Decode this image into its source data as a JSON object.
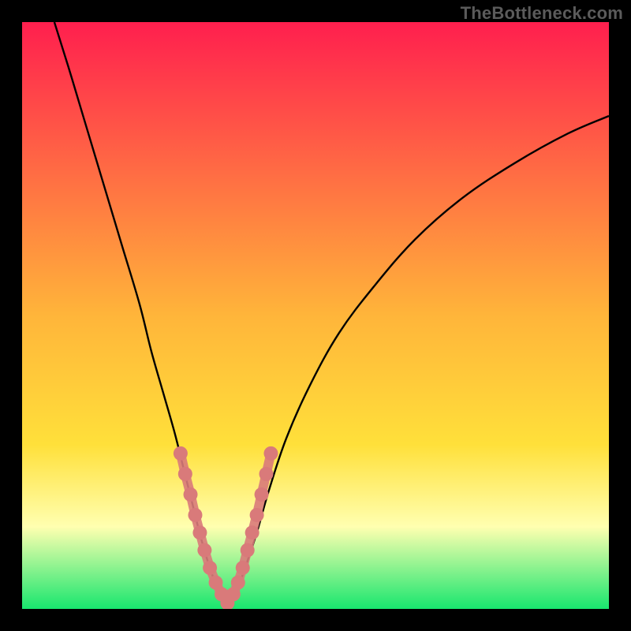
{
  "watermark": "TheBottleneck.com",
  "chart_data": {
    "type": "line",
    "title": "",
    "xlabel": "",
    "ylabel": "",
    "xlim": [
      0,
      100
    ],
    "ylim": [
      0,
      100
    ],
    "background_gradient_top": "#ff1f4e",
    "background_gradient_mid": "#ffe03a",
    "background_gradient_low": "#ffffb0",
    "background_gradient_bottom": "#18e66e",
    "series": [
      {
        "name": "bottleneck-curve-left",
        "stroke": "#000000",
        "x": [
          5.5,
          8,
          11,
          14,
          17,
          20,
          22,
          24,
          26,
          27.5,
          29,
          30.5,
          32,
          33.5,
          35
        ],
        "y": [
          100,
          92,
          82,
          72,
          62,
          52,
          44,
          37,
          30,
          24,
          18,
          12,
          7,
          3,
          1
        ]
      },
      {
        "name": "bottleneck-curve-right",
        "stroke": "#000000",
        "x": [
          35,
          36.5,
          38,
          40,
          42,
          45,
          49,
          54,
          60,
          67,
          75,
          84,
          93,
          100
        ],
        "y": [
          1,
          3,
          7,
          13,
          20,
          29,
          38,
          47,
          55,
          63,
          70,
          76,
          81,
          84
        ]
      },
      {
        "name": "highlight-dots",
        "stroke": "#d97a7a",
        "marker_fill": "#d97a7a",
        "marker_radius_px": 9,
        "x": [
          27.0,
          27.8,
          28.7,
          29.5,
          30.3,
          31.1,
          32.0,
          33.0,
          34.0,
          35.0,
          36.0,
          36.8,
          37.6,
          38.4,
          39.2,
          40.0,
          40.8,
          41.6,
          42.4
        ],
        "y": [
          26.5,
          23.0,
          19.5,
          16.0,
          13.0,
          10.0,
          7.0,
          4.5,
          2.5,
          1.0,
          2.5,
          4.5,
          7.0,
          10.0,
          13.0,
          16.0,
          19.5,
          23.0,
          26.5
        ]
      }
    ]
  }
}
